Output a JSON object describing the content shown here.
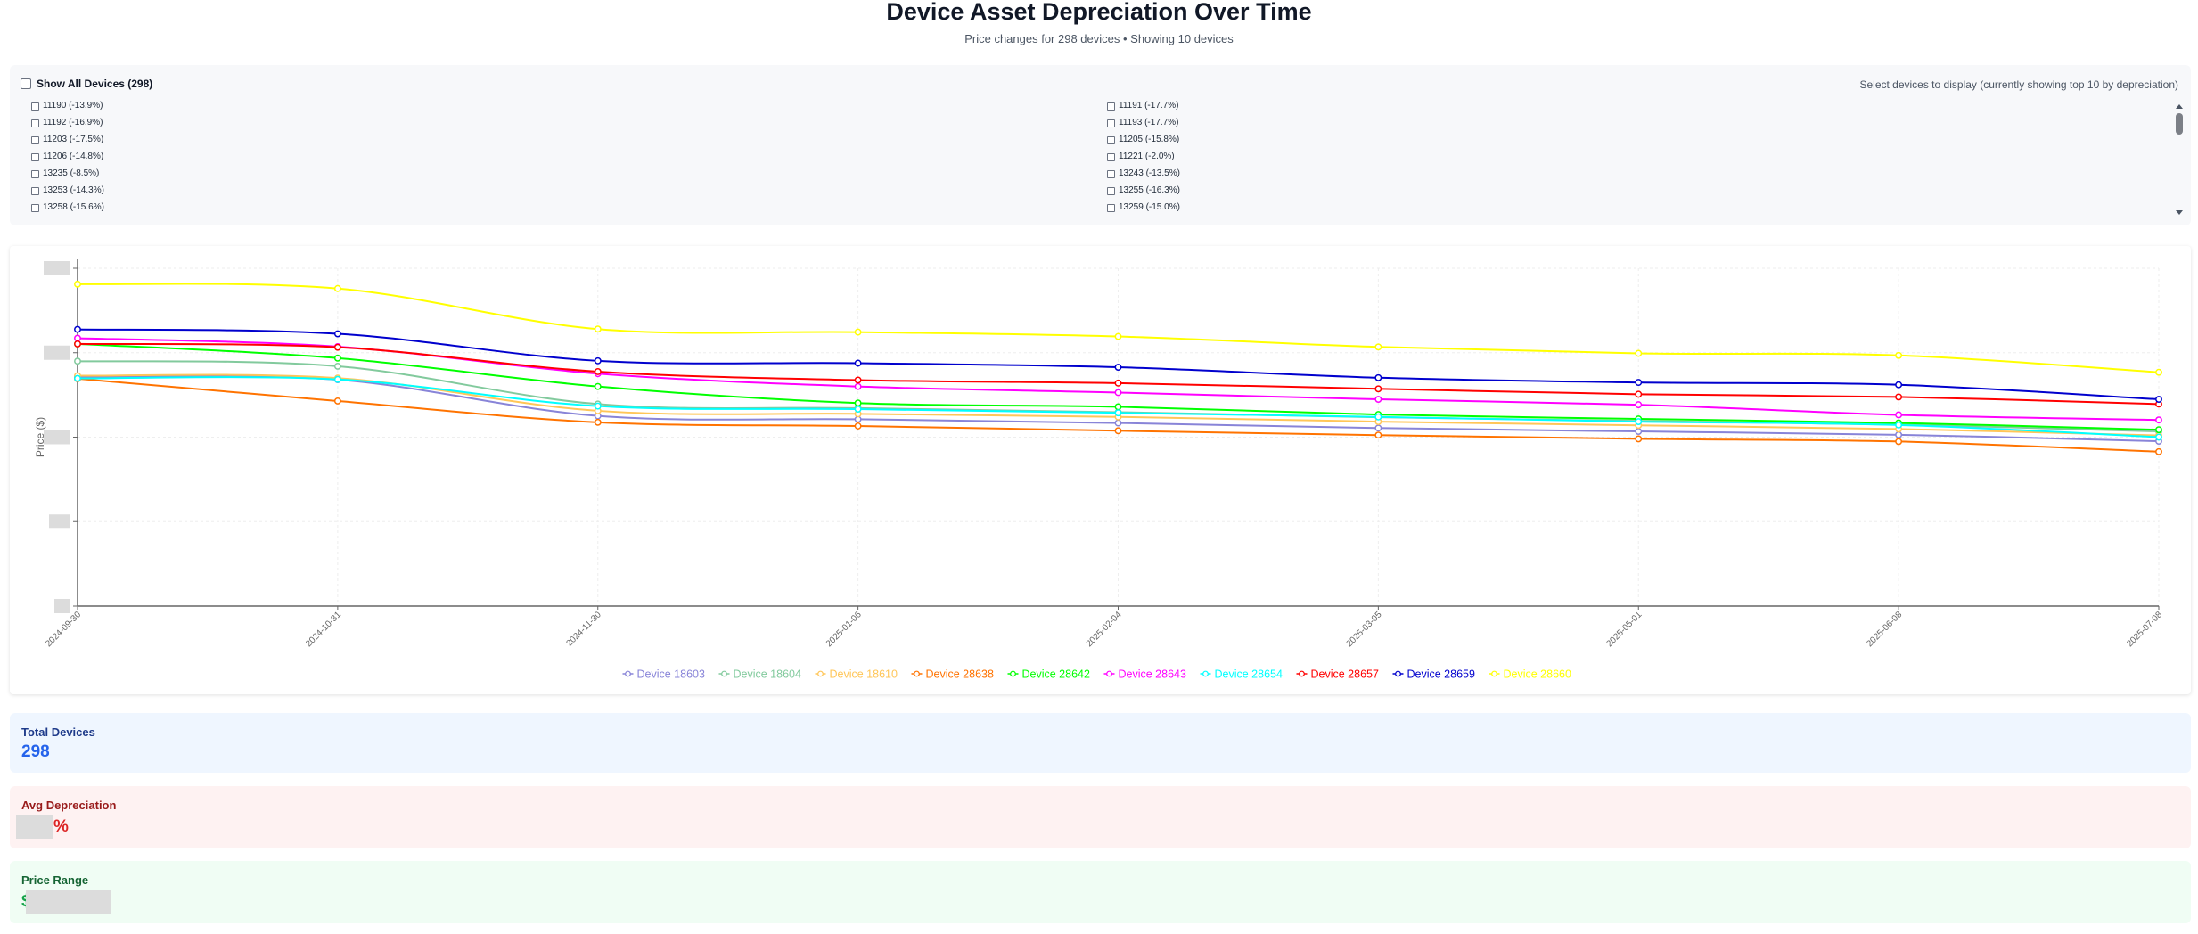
{
  "header": {
    "title": "Device Asset Depreciation Over Time",
    "subtitle": "Price changes for 298 devices • Showing 10 devices"
  },
  "selector": {
    "show_all_label": "Show All Devices (298)",
    "hint": "Select devices to display (currently showing top 10 by depreciation)",
    "devices": [
      "11190 (-13.9%)",
      "11191 (-17.7%)",
      "11192 (-16.9%)",
      "11193 (-17.7%)",
      "11203 (-17.5%)",
      "11205 (-15.8%)",
      "11206 (-14.8%)",
      "11221 (-2.0%)",
      "13235 (-8.5%)",
      "13243 (-13.5%)",
      "13253 (-14.3%)",
      "13255 (-16.3%)",
      "13258 (-15.6%)",
      "13259 (-15.0%)"
    ]
  },
  "chart_data": {
    "type": "line",
    "title": "",
    "xlabel": "",
    "ylabel": "Price ($)",
    "x": [
      "2024-09-30",
      "2024-10-31",
      "2024-11-30",
      "2025-01-06",
      "2025-02-04",
      "2025-03-05",
      "2025-05-01",
      "2025-06-08",
      "2025-07-08"
    ],
    "yaxis": {
      "min_px_value": 0,
      "max_value": 1.0
    },
    "grid": true,
    "legend_position": "bottom",
    "series": [
      {
        "name": "Device 18603",
        "color": "#8884d8",
        "values": [
          0.678,
          0.67,
          0.563,
          0.553,
          0.542,
          0.527,
          0.517,
          0.507,
          0.488
        ]
      },
      {
        "name": "Device 18604",
        "color": "#82ca9d",
        "values": [
          0.725,
          0.71,
          0.598,
          0.586,
          0.574,
          0.559,
          0.548,
          0.537,
          0.517
        ]
      },
      {
        "name": "Device 18610",
        "color": "#ffc658",
        "values": [
          0.682,
          0.675,
          0.578,
          0.569,
          0.56,
          0.546,
          0.535,
          0.524,
          0.505
        ]
      },
      {
        "name": "Device 28638",
        "color": "#ff7300",
        "values": [
          0.673,
          0.607,
          0.544,
          0.533,
          0.519,
          0.506,
          0.495,
          0.487,
          0.457
        ]
      },
      {
        "name": "Device 28642",
        "color": "#00ff00",
        "values": [
          0.776,
          0.734,
          0.65,
          0.601,
          0.59,
          0.567,
          0.554,
          0.542,
          0.522
        ]
      },
      {
        "name": "Device 28643",
        "color": "#ff00ff",
        "values": [
          0.793,
          0.768,
          0.688,
          0.65,
          0.632,
          0.612,
          0.596,
          0.566,
          0.551
        ]
      },
      {
        "name": "Device 28654",
        "color": "#00ffff",
        "values": [
          0.674,
          0.671,
          0.592,
          0.583,
          0.572,
          0.56,
          0.546,
          0.536,
          0.5
        ]
      },
      {
        "name": "Device 28657",
        "color": "#ff0000",
        "values": [
          0.776,
          0.766,
          0.694,
          0.669,
          0.66,
          0.643,
          0.627,
          0.619,
          0.598
        ]
      },
      {
        "name": "Device 28659",
        "color": "#0000cd",
        "values": [
          0.819,
          0.806,
          0.726,
          0.719,
          0.707,
          0.676,
          0.662,
          0.655,
          0.612
        ]
      },
      {
        "name": "Device 28660",
        "color": "#ffff00",
        "values": [
          0.953,
          0.94,
          0.82,
          0.811,
          0.798,
          0.767,
          0.748,
          0.742,
          0.692
        ]
      }
    ]
  },
  "stats": {
    "total_devices_label": "Total Devices",
    "total_devices_value": "298",
    "avg_depreciation_label": "Avg Depreciation",
    "avg_depreciation_suffix": "%",
    "price_range_label": "Price Range",
    "price_range_prefix": "$"
  }
}
